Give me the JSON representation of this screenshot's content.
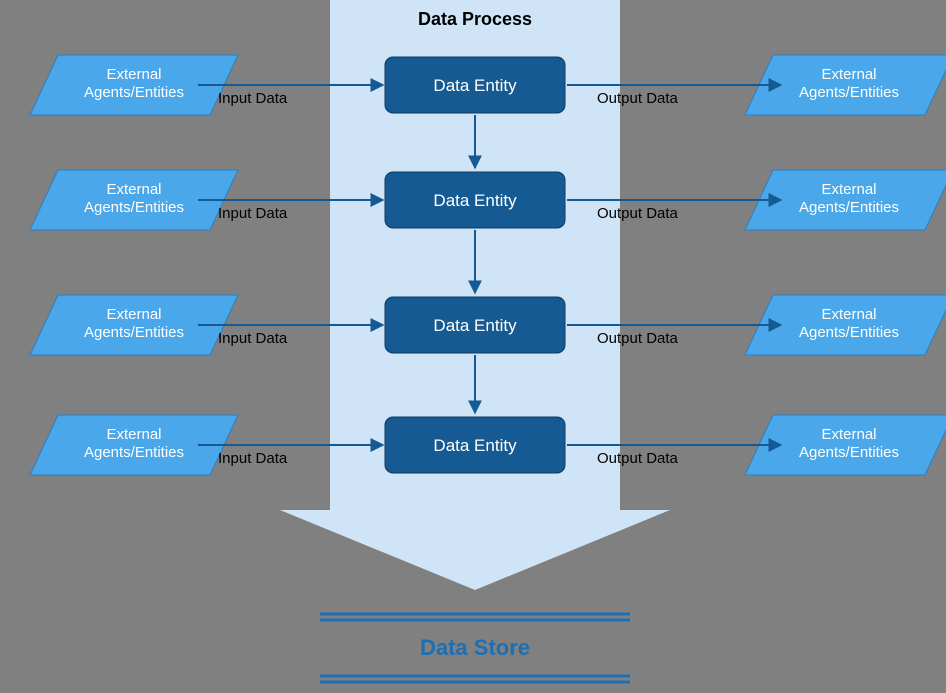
{
  "title": "Data Process",
  "store_label": "Data Store",
  "rows": [
    {
      "left": "External\nAgents/Entities",
      "input": "Input Data",
      "entity": "Data Entity",
      "output": "Output Data",
      "right": "External\nAgents/Entities"
    },
    {
      "left": "External\nAgents/Entities",
      "input": "Input Data",
      "entity": "Data Entity",
      "output": "Output Data",
      "right": "External\nAgents/Entities"
    },
    {
      "left": "External\nAgents/Entities",
      "input": "Input Data",
      "entity": "Data Entity",
      "output": "Output Data",
      "right": "External\nAgents/Entities"
    },
    {
      "left": "External\nAgents/Entities",
      "input": "Input Data",
      "entity": "Data Entity",
      "output": "Output Data",
      "right": "External\nAgents/Entities"
    }
  ],
  "colors": {
    "canvas_bg": "#808080",
    "process_fill": "#cfe5f7",
    "entity_fill": "#155a92",
    "entity_stroke": "#0e3a5e",
    "agent_fill": "#4aa7ea",
    "agent_stroke": "#2b7fc2",
    "arrow": "#155a92",
    "store_line": "#1c6fb5"
  }
}
